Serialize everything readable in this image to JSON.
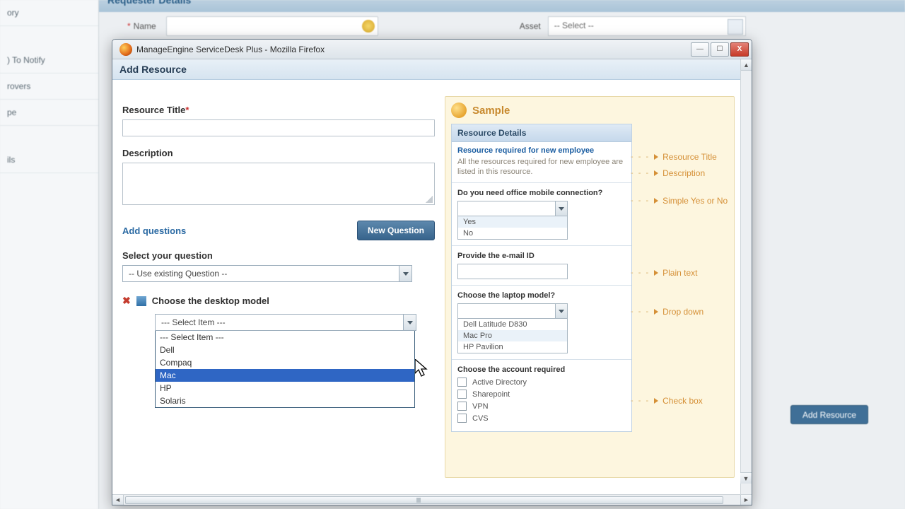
{
  "background": {
    "header": "Requester Details",
    "sidebar": [
      "ory",
      ") To Notify",
      "rovers",
      "pe",
      "ils"
    ],
    "name_label": "Name",
    "asset_label": "Asset",
    "asset_value": "-- Select --",
    "add_resource_btn": "Add Resource"
  },
  "window": {
    "title": "ManageEngine ServiceDesk Plus - Mozilla Firefox"
  },
  "page": {
    "header": "Add Resource",
    "resource_title_label": "Resource Title",
    "description_label": "Description",
    "add_questions_label": "Add questions",
    "new_question_btn": "New Question",
    "select_question_label": "Select your question",
    "select_question_value": "-- Use existing Question --",
    "chosen_question": "Choose the desktop model",
    "desktop_select_value": "--- Select Item ---",
    "desktop_options": [
      "--- Select Item ---",
      "Dell",
      "Compaq",
      "Mac",
      "HP",
      "Solaris"
    ],
    "desktop_highlight_index": 3
  },
  "sample": {
    "title": "Sample",
    "details_header": "Resource Details",
    "sub_title": "Resource required for new employee",
    "sub_desc": "All the resources required for new employee are listed in this resource.",
    "q1": "Do you need office mobile connection?",
    "q1_options": [
      "Yes",
      "No"
    ],
    "q2": "Provide the e-mail ID",
    "q3": "Choose the laptop model?",
    "q3_options": [
      "Dell Latitude D830",
      "Mac Pro",
      "HP Pavilion"
    ],
    "q4": "Choose the account required",
    "q4_options": [
      "Active Directory",
      "Sharepoint",
      "VPN",
      "CVS"
    ],
    "annot": {
      "a1": "Resource Title",
      "a2": "Description",
      "a3": "Simple Yes or No",
      "a4": "Plain text",
      "a5": "Drop down",
      "a6": "Check box"
    }
  }
}
